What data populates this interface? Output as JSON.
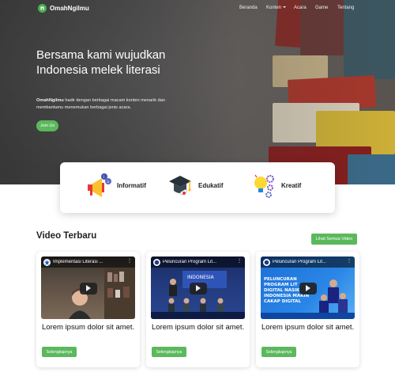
{
  "brand": {
    "name": "OmahNgilmu"
  },
  "nav": {
    "items": [
      "Beranda",
      "Konten",
      "Acara",
      "Game",
      "Tentang"
    ]
  },
  "hero": {
    "title": "Bersama kami wujudkan Indonesia melek literasi",
    "desc_brand": "OmahNgilmu",
    "desc_rest": " hadir dengan berbagai macam konten menarik dan membantumu menemukan berbagai jenis acara.",
    "cta": "Join Us"
  },
  "features": [
    {
      "label": "Informatif",
      "icon": "megaphone-icon"
    },
    {
      "label": "Edukatif",
      "icon": "graduation-cap-icon"
    },
    {
      "label": "Kreatif",
      "icon": "lightbulb-gears-icon"
    }
  ],
  "videos": {
    "title": "Video Terbaru",
    "see_all": "Lihat Semua Video",
    "items": [
      {
        "thumb_title": "Implementasi Literasi ...",
        "title": "Lorem ipsum dolor sit amet.",
        "button": "Selengkapnya"
      },
      {
        "thumb_title": "Peluncuran Program Lit...",
        "title": "Lorem ipsum dolor sit amet.",
        "button": "Selengkapnya"
      },
      {
        "thumb_title": "Peluncuran Program Lit...",
        "title": "Lorem ipsum dolor sit amet.",
        "button": "Selengkapnya"
      }
    ]
  },
  "colors": {
    "accent": "#5cb85c",
    "hero_bg": "#5a5959"
  }
}
